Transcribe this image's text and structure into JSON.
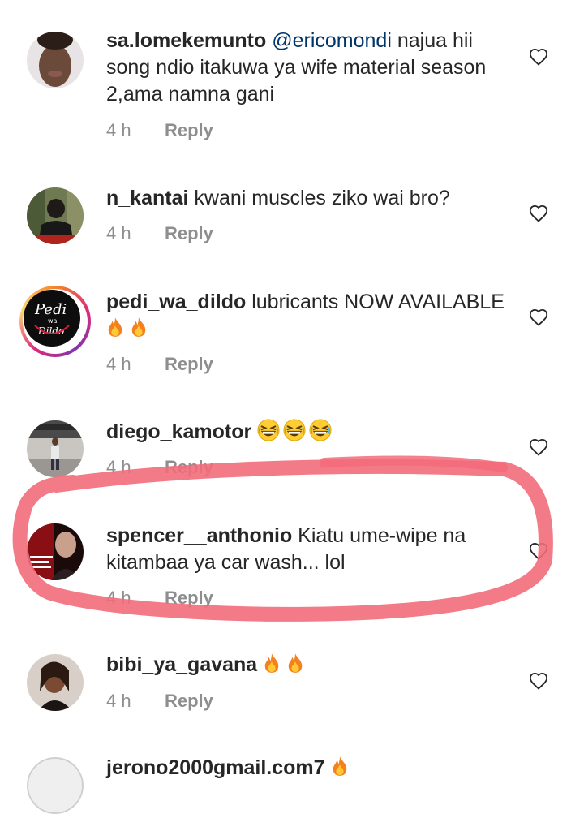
{
  "comments": [
    {
      "username": "sa.lomekemunto",
      "mention": "@ericomondi",
      "text_after_mention": " najua hii song ndio itakuwa ya wife material season 2,ama namna gani",
      "time": "4 h",
      "reply": "Reply"
    },
    {
      "username": "n_kantai",
      "text": " kwani muscles ziko wai bro?",
      "time": "4 h",
      "reply": "Reply"
    },
    {
      "username": "pedi_wa_dildo",
      "text": " lubricants NOW AVAILABLE ",
      "emojis": [
        "fire-emoji",
        "fire-emoji"
      ],
      "time": "4 h",
      "reply": "Reply",
      "avatar_text": {
        "line1": "Pedi",
        "line2": "wa",
        "line3": "Dildo"
      }
    },
    {
      "username": "diego_kamotor",
      "emojis": [
        "grinning-squinting-emoji",
        "grinning-squinting-emoji",
        "grinning-squinting-emoji"
      ],
      "time": "4 h",
      "reply": "Reply"
    },
    {
      "username": "spencer__anthonio",
      "text": " Kiatu ume-wipe na kitambaa ya car wash... lol",
      "time": "4 h",
      "reply": "Reply"
    },
    {
      "username": "bibi_ya_gavana",
      "emojis": [
        "fire-emoji",
        "fire-emoji"
      ],
      "time": "4 h",
      "reply": "Reply"
    },
    {
      "username": "jerono2000gmail.com7",
      "emojis": [
        "fire-emoji"
      ]
    }
  ],
  "colors": {
    "username": "#262626",
    "mention": "#003569",
    "meta": "#8e8e8e",
    "highlight": "#f26b7a"
  }
}
